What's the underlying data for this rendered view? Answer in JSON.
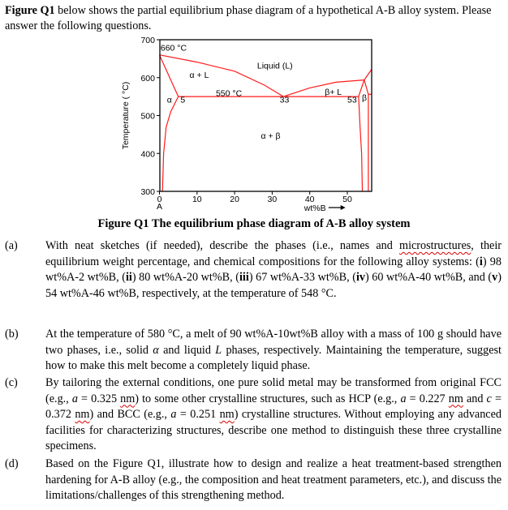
{
  "intro": {
    "bold": "Figure Q1",
    "text": " below shows the partial equilibrium phase diagram of a hypothetical A-B alloy system. Please answer the following questions."
  },
  "caption": "Figure Q1 The equilibrium phase diagram of A-B alloy system",
  "chart_data": {
    "type": "line",
    "title": "",
    "xlabel": "wt%B",
    "ylabel": "Temperature ( °C)",
    "xlim": [
      0,
      57
    ],
    "ylim": [
      300,
      700
    ],
    "x_ticks": [
      0,
      10,
      20,
      30,
      40,
      50
    ],
    "y_ticks": [
      300,
      400,
      500,
      600,
      700
    ],
    "x_origin_sublabel": "A",
    "grid": false,
    "color": "#ff1a1a",
    "series": [
      {
        "name": "liquidus-alpha",
        "points": [
          [
            0,
            660
          ],
          [
            10,
            641
          ],
          [
            20,
            617
          ],
          [
            28,
            580
          ],
          [
            33,
            550
          ]
        ]
      },
      {
        "name": "liquidus-beta",
        "points": [
          [
            33,
            550
          ],
          [
            40,
            573
          ],
          [
            47,
            588
          ],
          [
            54.5,
            594
          ]
        ]
      },
      {
        "name": "liquidus-beta-upper",
        "points": [
          [
            54.5,
            594
          ],
          [
            57,
            622
          ]
        ]
      },
      {
        "name": "solidus-alpha",
        "points": [
          [
            0,
            660
          ],
          [
            5,
            550
          ]
        ]
      },
      {
        "name": "eutectic-isotherm",
        "points": [
          [
            5,
            550
          ],
          [
            53,
            550
          ]
        ]
      },
      {
        "name": "solvus-alpha",
        "points": [
          [
            5,
            550
          ],
          [
            3,
            510
          ],
          [
            1.8,
            470
          ],
          [
            1.1,
            400
          ],
          [
            0.8,
            300
          ]
        ]
      },
      {
        "name": "solidus-beta",
        "points": [
          [
            53,
            550
          ],
          [
            54.5,
            594
          ]
        ]
      },
      {
        "name": "beta-right-boundary",
        "points": [
          [
            54.5,
            594
          ],
          [
            55.6,
            556
          ],
          [
            55.6,
            300
          ]
        ]
      },
      {
        "name": "beta-right-horizontal",
        "points": [
          [
            55.6,
            556
          ],
          [
            57,
            556
          ]
        ]
      },
      {
        "name": "solvus-beta",
        "points": [
          [
            53,
            550
          ],
          [
            53.4,
            470
          ],
          [
            53.8,
            400
          ],
          [
            54,
            300
          ]
        ]
      }
    ],
    "annotations": [
      {
        "text": "660 °C",
        "x": 0.3,
        "y": 680
      },
      {
        "text": "Liquid (L)",
        "x": 26,
        "y": 633
      },
      {
        "text": "α + L",
        "x": 8,
        "y": 608
      },
      {
        "text": "550 °C",
        "x": 15,
        "y": 560
      },
      {
        "text": "β+ L",
        "x": 44,
        "y": 563
      },
      {
        "text": "α",
        "x": 2,
        "y": 543
      },
      {
        "text": "5",
        "x": 5.6,
        "y": 543
      },
      {
        "text": "33",
        "x": 32,
        "y": 543
      },
      {
        "text": "53",
        "x": 50,
        "y": 543
      },
      {
        "text": "β",
        "x": 53.9,
        "y": 548
      },
      {
        "text": "α + β",
        "x": 27,
        "y": 448
      }
    ]
  },
  "questions": [
    {
      "label": "(a)",
      "parts": [
        {
          "t": "With neat sketches (if needed), describe the phases (i.e., names and "
        },
        {
          "t": "microstructures",
          "squig": true
        },
        {
          "t": ", their equilibrium weight percentage, and chemical compositions for the following alloy systems: ("
        },
        {
          "t": "i",
          "b": true
        },
        {
          "t": ") 98 wt%A-2 wt%B, ("
        },
        {
          "t": "ii",
          "b": true
        },
        {
          "t": ") 80 wt%A-20 wt%B, ("
        },
        {
          "t": "iii",
          "b": true
        },
        {
          "t": ") 67 wt%A-33 wt%B, ("
        },
        {
          "t": "iv",
          "b": true
        },
        {
          "t": ") 60 wt%A-40 wt%B, and ("
        },
        {
          "t": "v",
          "b": true
        },
        {
          "t": ") 54 wt%A-46 wt%B, respectively, at the temperature of 548 °C."
        }
      ]
    },
    {
      "label": "(b)",
      "parts": [
        {
          "t": "At the temperature of 580 °C, a melt of 90 wt%A-10wt%B alloy with a mass of 100 g should have two phases, i.e., solid "
        },
        {
          "t": "α",
          "i": true
        },
        {
          "t": " and liquid "
        },
        {
          "t": "L",
          "i": true
        },
        {
          "t": " phases, respectively. Maintaining the temperature, suggest how to make this melt become a completely liquid phase."
        }
      ]
    },
    {
      "label": "(c)",
      "parts": [
        {
          "t": "By tailoring the external conditions, one pure solid metal may be transformed from original FCC (e.g., "
        },
        {
          "t": "a",
          "i": true
        },
        {
          "t": " = 0.325 "
        },
        {
          "t": "nm",
          "squig": true
        },
        {
          "t": ") to some other crystalline structures, such as HCP (e.g., "
        },
        {
          "t": "a",
          "i": true
        },
        {
          "t": " = 0.227 "
        },
        {
          "t": "nm",
          "squig": true
        },
        {
          "t": " and "
        },
        {
          "t": "c",
          "i": true
        },
        {
          "t": " = 0.372 "
        },
        {
          "t": "nm",
          "squig": true
        },
        {
          "t": ") and BCC (e.g., "
        },
        {
          "t": "a",
          "i": true
        },
        {
          "t": " = 0.251 "
        },
        {
          "t": "nm",
          "squig": true
        },
        {
          "t": ") crystalline structures. Without employing any advanced facilities for characterizing structures, describe one method to distinguish these three crystalline specimens."
        }
      ]
    },
    {
      "label": "(d)",
      "parts": [
        {
          "t": "Based on the Figure Q1, illustrate how to design and realize a heat treatment-based strengthen hardening for A-B alloy (e.g., the composition and heat treatment parameters, etc.), and discuss the limitations/challenges of this strengthening method."
        }
      ]
    }
  ]
}
